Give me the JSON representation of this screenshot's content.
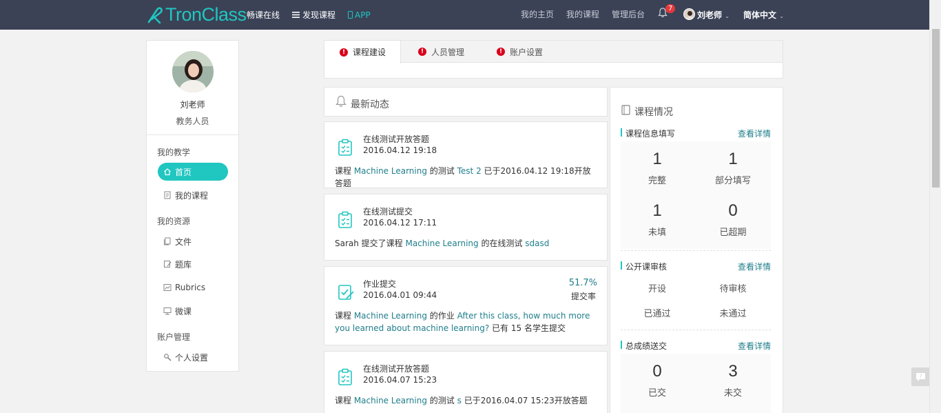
{
  "nav": {
    "brand": "TronClass",
    "items": [
      "畅课在线",
      "发现课程",
      "APP"
    ],
    "right_links": [
      "我的主页",
      "我的课程",
      "管理后台"
    ],
    "notification_count": "7",
    "user_name": "刘老师",
    "language": "简体中文"
  },
  "profile": {
    "name": "刘老师",
    "role": "教务人员"
  },
  "sidebar": {
    "sections": [
      {
        "title": "我的教学",
        "items": [
          {
            "label": "首页",
            "icon": "home-icon"
          },
          {
            "label": "我的课程",
            "icon": "book-icon"
          }
        ]
      },
      {
        "title": "我的资源",
        "items": [
          {
            "label": "文件",
            "icon": "files-icon"
          },
          {
            "label": "题库",
            "icon": "question-bank-icon"
          },
          {
            "label": "Rubrics",
            "icon": "rubrics-icon"
          },
          {
            "label": "微课",
            "icon": "microlecture-icon"
          }
        ]
      },
      {
        "title": "账户管理",
        "items": [
          {
            "label": "个人设置",
            "icon": "settings-icon"
          }
        ]
      }
    ]
  },
  "tabs": [
    "课程建设",
    "人员管理",
    "账户设置"
  ],
  "feed": {
    "title": "最新动态",
    "cards": [
      {
        "title": "在线测试开放答题",
        "date": "2016.04.12 19:18",
        "parts": [
          "课程 ",
          "Machine Learning",
          " 的测试 ",
          "Test 2",
          " 已于2016.04.12 19:18开放答题"
        ]
      },
      {
        "title": "在线测试提交",
        "date": "2016.04.12 17:11",
        "parts": [
          "Sarah 提交了课程 ",
          "Machine Learning",
          " 的在线测试 ",
          "sdasd",
          ""
        ]
      },
      {
        "title": "作业提交",
        "date": "2016.04.01 09:44",
        "rate": "51.7%",
        "rate_label": "提交率",
        "parts": [
          "课程 ",
          "Machine Learning",
          " 的作业 ",
          "After this class, how much more you learned about machine learning?",
          " 已有 15 名学生提交"
        ]
      },
      {
        "title": "在线测试开放答题",
        "date": "2016.04.07 15:23",
        "parts": [
          "课程 ",
          "Machine Learning",
          " 的测试 ",
          "s",
          " 已于2016.04.07 15:23开放答题"
        ]
      }
    ]
  },
  "course_status": {
    "title": "课程情况",
    "info_fill": {
      "label": "课程信息填写",
      "more": "查看详情",
      "stats": [
        {
          "value": "1",
          "caption": "完整"
        },
        {
          "value": "1",
          "caption": "部分填写"
        },
        {
          "value": "1",
          "caption": "未填"
        },
        {
          "value": "0",
          "caption": "已超期"
        }
      ]
    },
    "public_review": {
      "label": "公开课审核",
      "more": "查看详情",
      "items": [
        "开设",
        "待审核",
        "已通过",
        "未通过"
      ]
    },
    "grade_submit": {
      "label": "总成绩送交",
      "more": "查看详情",
      "stats": [
        {
          "value": "0",
          "caption": "已交"
        },
        {
          "value": "3",
          "caption": "未交"
        }
      ]
    }
  },
  "colors": {
    "topbar": "#3b4256",
    "accent": "#20c6c0",
    "link": "#1f7e8b",
    "warning": "#d9001b"
  }
}
